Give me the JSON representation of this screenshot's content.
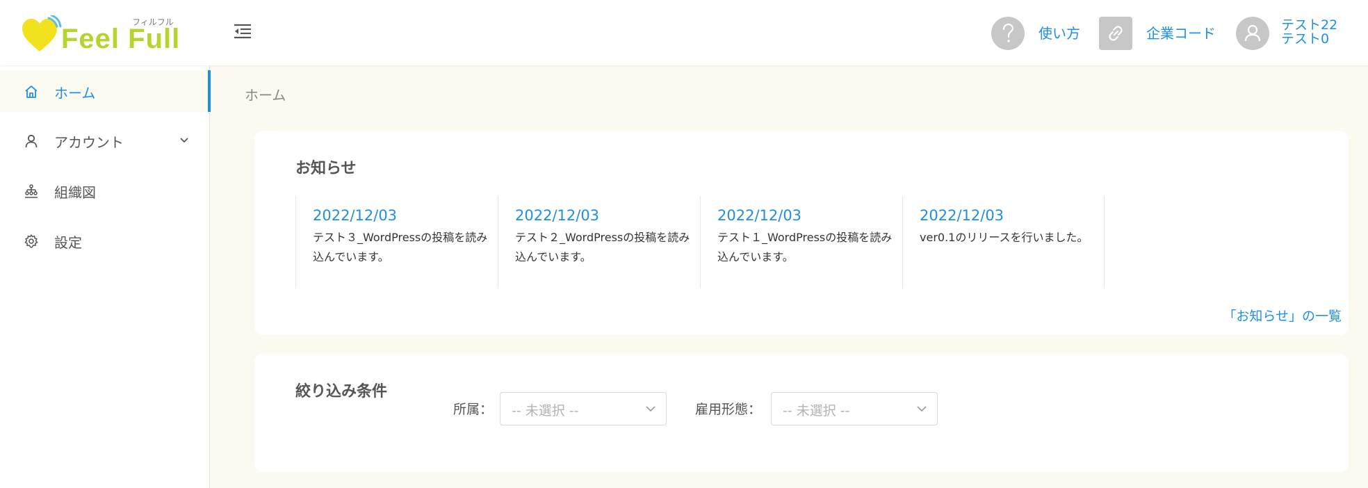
{
  "header": {
    "logo_text": "Feel Full",
    "logo_ruby": "フィルフル",
    "help_label": "使い方",
    "company_code_label": "企業コード",
    "user": {
      "line1": "テスト22",
      "line2": "テスト0"
    }
  },
  "sidebar": {
    "items": [
      {
        "label": "ホーム",
        "icon": "home-icon",
        "active": true
      },
      {
        "label": "アカウント",
        "icon": "user-icon",
        "active": false
      },
      {
        "label": "組織図",
        "icon": "org-chart-icon",
        "active": false
      },
      {
        "label": "設定",
        "icon": "gear-icon",
        "active": false
      }
    ]
  },
  "breadcrumb": "ホーム",
  "notices": {
    "title": "お知らせ",
    "items": [
      {
        "date": "2022/12/03",
        "text": "テスト３_WordPressの投稿を読み込んでいます。"
      },
      {
        "date": "2022/12/03",
        "text": "テスト２_WordPressの投稿を読み込んでいます。"
      },
      {
        "date": "2022/12/03",
        "text": "テスト１_WordPressの投稿を読み込んでいます。"
      },
      {
        "date": "2022/12/03",
        "text": "ver0.1のリリースを行いました。"
      }
    ],
    "more_link": "「お知らせ」の一覧"
  },
  "filter": {
    "title": "絞り込み条件",
    "department_label": "所属：",
    "department_value": "-- 未選択 --",
    "employment_label": "雇用形態：",
    "employment_value": "-- 未選択 --"
  },
  "colors": {
    "accent": "#1e8fe6",
    "brand": "#b6d42e",
    "heart": "#f2e21e",
    "background": "#fafaf0"
  }
}
